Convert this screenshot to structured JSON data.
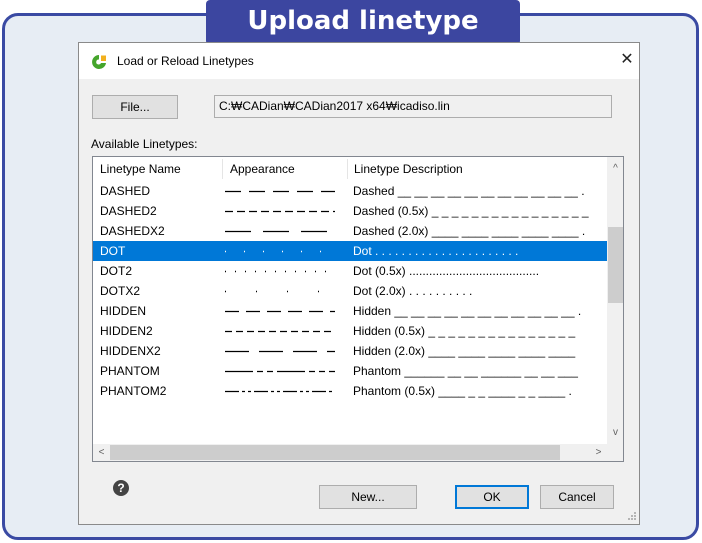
{
  "banner": {
    "title": "Upload linetype"
  },
  "dialog": {
    "title": "Load or Reload Linetypes",
    "close_glyph": "✕",
    "file_button": "File...",
    "file_path": "C:₩CADian₩CADian2017 x64₩icadiso.lin",
    "available_label": "Available Linetypes:",
    "columns": [
      "Linetype Name",
      "Appearance",
      "Linetype Description"
    ],
    "rows": [
      {
        "name": "DASHED",
        "description": "Dashed __ __ __ __ __ __ __ __ __ __ __ .",
        "pattern": "dashed",
        "selected": false
      },
      {
        "name": "DASHED2",
        "description": "Dashed (0.5x) _ _ _ _ _ _ _ _ _ _ _ _ _ _ _ _",
        "pattern": "dashed2",
        "selected": false
      },
      {
        "name": "DASHEDX2",
        "description": "Dashed (2.0x) ____ ____ ____ ____ ____ .",
        "pattern": "dashedx2",
        "selected": false
      },
      {
        "name": "DOT",
        "description": "Dot . . . . . . . . . . . . . . . . . . . . . .",
        "pattern": "dot",
        "selected": true
      },
      {
        "name": "DOT2",
        "description": "Dot (0.5x) .......................................",
        "pattern": "dot2",
        "selected": false
      },
      {
        "name": "DOTX2",
        "description": "Dot (2.0x) .   .   .   .   .   .   .   .   .   .",
        "pattern": "dotx2",
        "selected": false
      },
      {
        "name": "HIDDEN",
        "description": "Hidden __ __ __ __ __ __ __ __ __ __ __ .",
        "pattern": "hidden",
        "selected": false
      },
      {
        "name": "HIDDEN2",
        "description": "Hidden (0.5x) _ _ _ _ _ _ _ _ _ _ _ _ _ _ _",
        "pattern": "hidden2",
        "selected": false
      },
      {
        "name": "HIDDENX2",
        "description": "Hidden (2.0x) ____ ____ ____ ____ ____",
        "pattern": "hiddenx2",
        "selected": false
      },
      {
        "name": "PHANTOM",
        "description": "Phantom ______ __ __ ______ __ __ ___",
        "pattern": "phantom",
        "selected": false
      },
      {
        "name": "PHANTOM2",
        "description": "Phantom (0.5x) ____ _ _ ____ _ _ ____ .",
        "pattern": "phantom2",
        "selected": false
      }
    ],
    "scroll_up": "^",
    "scroll_down": "v",
    "scroll_left": "<",
    "scroll_right": ">",
    "help_glyph": "?",
    "new_button": "New...",
    "ok_button": "OK",
    "cancel_button": "Cancel"
  },
  "colors": {
    "banner": "#3c46a0",
    "frame_border": "#3a4aa3",
    "frame_bg": "#e7edf4",
    "selection": "#0078d7",
    "app_icon_green": "#45a52c"
  },
  "icons": {
    "app": "cadian-logo-icon",
    "close": "close-icon",
    "help": "help-icon",
    "grip": "resize-grip-icon"
  }
}
